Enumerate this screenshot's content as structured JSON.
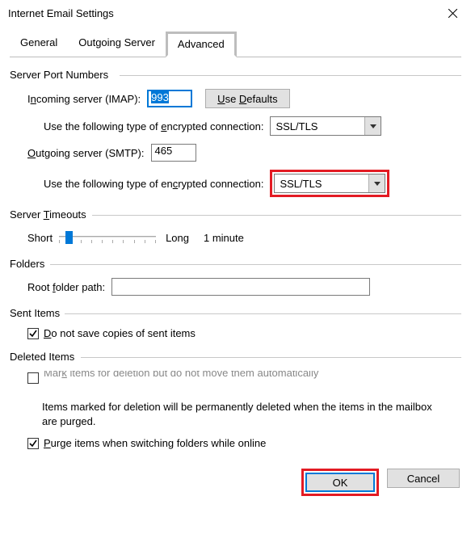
{
  "window": {
    "title": "Internet Email Settings"
  },
  "tabs": {
    "general": "General",
    "outgoing": "Outgoing Server",
    "advanced": "Advanced"
  },
  "serverPorts": {
    "legend": "Server Port Numbers",
    "incomingLabelPre": "I",
    "incomingLabelU": "n",
    "incomingLabelPost": "coming server (IMAP):",
    "incomingValue": "993",
    "defaultsBtn": "Use Defaults",
    "encIncomingPre": "Use the following type of ",
    "encIncomingU": "e",
    "encIncomingPost": "ncrypted connection:",
    "encIncomingValue": "SSL/TLS",
    "outgoingLabelU": "O",
    "outgoingLabelPost": "utgoing server (SMTP):",
    "outgoingValue": "465",
    "encOutgoingPre": "Use the following type of en",
    "encOutgoingU": "c",
    "encOutgoingPost": "rypted connection:",
    "encOutgoingValue": "SSL/TLS"
  },
  "timeouts": {
    "legendPre": "Server ",
    "legendU": "T",
    "legendPost": "imeouts",
    "short": "Short",
    "long": "Long",
    "value": "1 minute"
  },
  "folders": {
    "legend": "Folders",
    "rootLabelPre": "Root ",
    "rootLabelU": "f",
    "rootLabelPost": "older path:",
    "rootValue": ""
  },
  "sentItems": {
    "legend": "Sent Items",
    "doNotSavePre": "",
    "doNotSaveU": "D",
    "doNotSavePost": "o not save copies of sent items"
  },
  "deletedItems": {
    "legend": "Deleted Items",
    "markPre": "Mar",
    "markU": "k",
    "markPost": " items for deletion but do not move them automatically",
    "note": "Items marked for deletion will be permanently deleted when the items in the mailbox are purged.",
    "purgeU": "P",
    "purgePost": "urge items when switching folders while online"
  },
  "footer": {
    "ok": "OK",
    "cancel": "Cancel"
  }
}
